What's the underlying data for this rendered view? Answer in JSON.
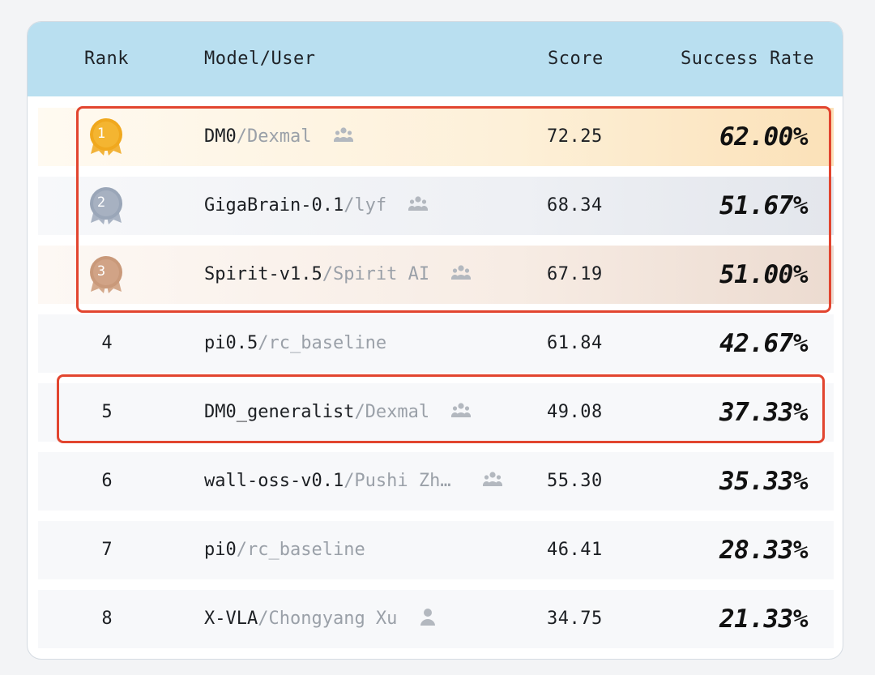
{
  "header": {
    "rank": "Rank",
    "model_user": "Model/User",
    "score": "Score",
    "success_rate": "Success Rate"
  },
  "rows": [
    {
      "rank": "1",
      "model": "DM0",
      "user": "/Dexmal",
      "icon": "group-icon",
      "score": "72.25",
      "success_rate": "62.00%",
      "medal": "gold"
    },
    {
      "rank": "2",
      "model": "GigaBrain-0.1",
      "user": "/lyf",
      "icon": "group-icon",
      "score": "68.34",
      "success_rate": "51.67%",
      "medal": "silver"
    },
    {
      "rank": "3",
      "model": "Spirit-v1.5",
      "user": "/Spirit AI",
      "icon": "group-icon",
      "score": "67.19",
      "success_rate": "51.00%",
      "medal": "bronze"
    },
    {
      "rank": "4",
      "model": "pi0.5",
      "user": "/rc_baseline",
      "icon": "",
      "score": "61.84",
      "success_rate": "42.67%"
    },
    {
      "rank": "5",
      "model": "DM0_generalist",
      "user": "/Dexmal",
      "icon": "group-icon",
      "score": "49.08",
      "success_rate": "37.33%"
    },
    {
      "rank": "6",
      "model": "wall-oss-v0.1",
      "user": "/Pushi Zh…",
      "icon": "group-icon",
      "score": "55.30",
      "success_rate": "35.33%"
    },
    {
      "rank": "7",
      "model": "pi0",
      "user": "/rc_baseline",
      "icon": "",
      "score": "46.41",
      "success_rate": "28.33%"
    },
    {
      "rank": "8",
      "model": "X-VLA",
      "user": "/Chongyang Xu",
      "icon": "person-icon",
      "score": "34.75",
      "success_rate": "21.33%"
    }
  ],
  "colors": {
    "header_bg": "#b9dff0",
    "highlight": "#e2452f",
    "gold": "#f0a81e",
    "silver": "#9aa6b8",
    "bronze": "#c9997a"
  }
}
